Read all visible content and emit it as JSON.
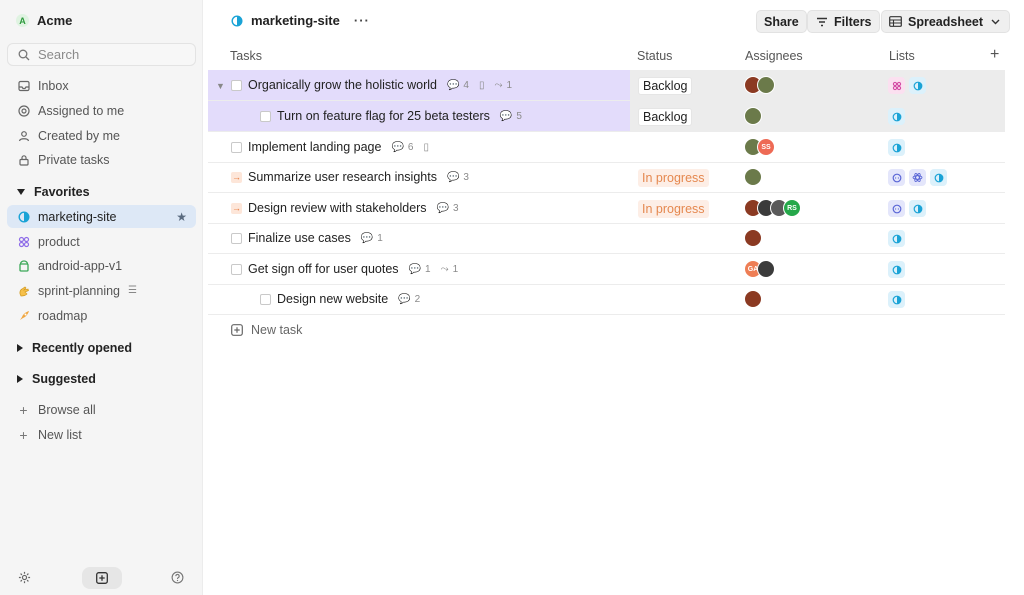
{
  "workspace": {
    "initial": "A",
    "name": "Acme"
  },
  "search": {
    "placeholder": "Search"
  },
  "nav": {
    "inbox": "Inbox",
    "assigned": "Assigned to me",
    "created": "Created by me",
    "private": "Private tasks"
  },
  "favorites": {
    "title": "Favorites",
    "items": [
      "marketing-site",
      "product",
      "android-app-v1",
      "sprint-planning",
      "roadmap"
    ]
  },
  "sections": {
    "recent": "Recently opened",
    "suggested": "Suggested"
  },
  "sidebar_actions": {
    "browse": "Browse all",
    "new_list": "New list"
  },
  "header": {
    "list_name": "marketing-site",
    "more": "···",
    "share": "Share",
    "filters": "Filters",
    "view": "Spreadsheet"
  },
  "columns": {
    "tasks": "Tasks",
    "status": "Status",
    "assignees": "Assignees",
    "lists": "Lists"
  },
  "rows": [
    {
      "name": "Organically grow the holistic world",
      "comments": "4",
      "links": "1",
      "status": "Backlog"
    },
    {
      "name": "Turn on feature flag for 25 beta testers",
      "comments": "5",
      "status": "Backlog"
    },
    {
      "name": "Implement landing page",
      "comments": "6"
    },
    {
      "name": "Summarize user research insights",
      "comments": "3",
      "status": "In progress"
    },
    {
      "name": "Design review with stakeholders",
      "comments": "3",
      "status": "In progress"
    },
    {
      "name": "Finalize use cases",
      "comments": "1"
    },
    {
      "name": "Get sign off for user quotes",
      "comments": "1",
      "links": "1"
    },
    {
      "name": "Design new website",
      "comments": "2"
    }
  ],
  "avatar_initials": {
    "ss": "SS",
    "rs": "RS",
    "ga": "GA"
  },
  "new_task": "New task",
  "colors": {
    "accent": "#1aa3d6",
    "selection": "#e3dcfb",
    "in_progress": "#e5884f"
  }
}
